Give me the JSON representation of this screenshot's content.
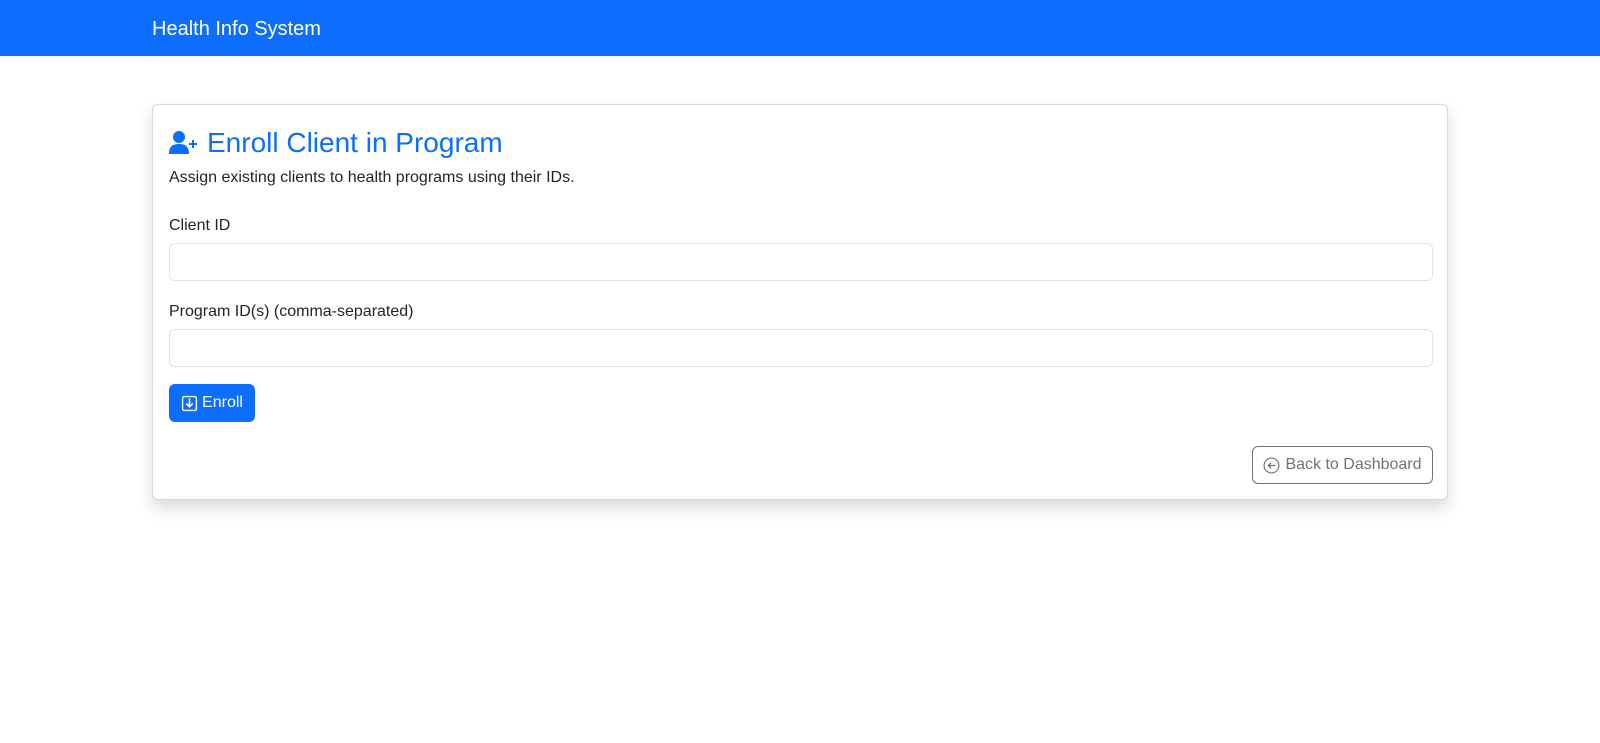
{
  "navbar": {
    "brand": "Health Info System"
  },
  "card": {
    "title_icon": "person-plus-icon",
    "title": "Enroll Client in Program",
    "subtitle": "Assign existing clients to health programs using their IDs.",
    "fields": {
      "client_id": {
        "label": "Client ID",
        "value": "",
        "placeholder": ""
      },
      "program_ids": {
        "label": "Program ID(s) (comma-separated)",
        "value": "",
        "placeholder": ""
      }
    },
    "enroll_button": {
      "icon": "box-arrow-in-down-icon",
      "label": "Enroll"
    },
    "back_button": {
      "icon": "arrow-left-circle-icon",
      "label": "Back to Dashboard"
    }
  },
  "colors": {
    "primary": "#0d6efd",
    "secondary": "#6c757d"
  }
}
